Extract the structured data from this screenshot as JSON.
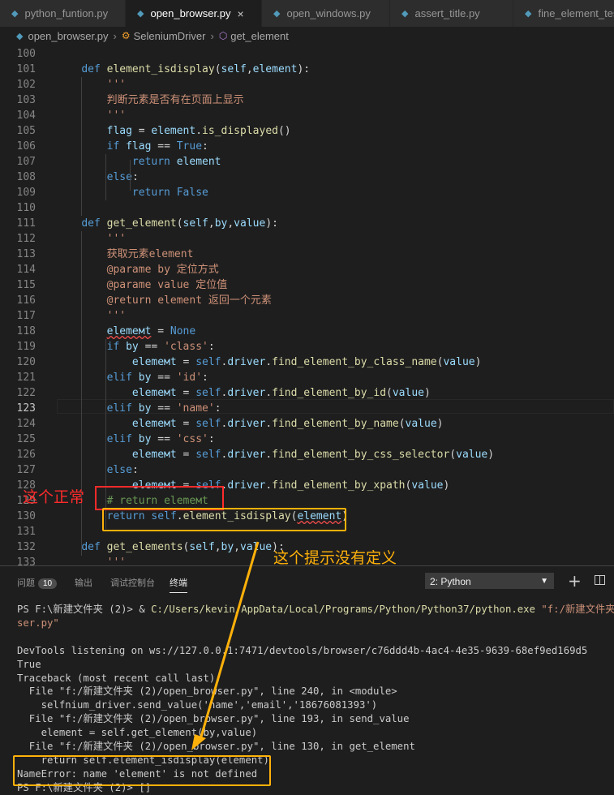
{
  "tabs": [
    {
      "label": "python_funtion.py",
      "active": false
    },
    {
      "label": "open_browser.py",
      "active": true
    },
    {
      "label": "open_windows.py",
      "active": false
    },
    {
      "label": "assert_title.py",
      "active": false
    },
    {
      "label": "fine_element_tes",
      "active": false
    }
  ],
  "breadcrumb": {
    "file": "open_browser.py",
    "class": "SeleniumDriver",
    "method": "get_element"
  },
  "code_lines": [
    {
      "n": "100",
      "html": ""
    },
    {
      "n": "101",
      "html": "    <span class='k'>def</span> <span class='f'>element_isdisplay</span>(<span class='v'>self</span>,<span class='v'>element</span>):"
    },
    {
      "n": "102",
      "html": "        <span class='s'>'''</span>"
    },
    {
      "n": "103",
      "html": "        <span class='s'>判断元素是否有在页面上显示</span>"
    },
    {
      "n": "104",
      "html": "        <span class='s'>'''</span>"
    },
    {
      "n": "105",
      "html": "        <span class='v'>flag</span> = <span class='v'>element</span>.<span class='f'>is_displayed</span>()"
    },
    {
      "n": "106",
      "html": "        <span class='k'>if</span> <span class='v'>flag</span> == <span class='k'>True</span>:"
    },
    {
      "n": "107",
      "html": "            <span class='k'>return</span> <span class='v'>element</span>"
    },
    {
      "n": "108",
      "html": "        <span class='k'>else</span>:"
    },
    {
      "n": "109",
      "html": "            <span class='k'>return</span> <span class='k'>False</span>"
    },
    {
      "n": "110",
      "html": ""
    },
    {
      "n": "111",
      "html": "    <span class='k'>def</span> <span class='f'>get_element</span>(<span class='v'>self</span>,<span class='v'>by</span>,<span class='v'>value</span>):"
    },
    {
      "n": "112",
      "html": "        <span class='s'>'''</span>"
    },
    {
      "n": "113",
      "html": "        <span class='s'>获取元素element</span>"
    },
    {
      "n": "114",
      "html": "        <span class='s'>@parame by 定位方式</span>"
    },
    {
      "n": "115",
      "html": "        <span class='s'>@parame value 定位值</span>"
    },
    {
      "n": "116",
      "html": "        <span class='s'>@return element 返回一个元素</span>"
    },
    {
      "n": "117",
      "html": "        <span class='s'>'''</span>"
    },
    {
      "n": "118",
      "html": "        <span class='v sq'>elemeмt</span> = <span class='k'>None</span>"
    },
    {
      "n": "119",
      "html": "        <span class='k'>if</span> <span class='v'>by</span> == <span class='s'>'class'</span>:"
    },
    {
      "n": "120",
      "html": "            <span class='v'>elemeмt</span> = <span class='k'>self</span>.<span class='v'>driver</span>.<span class='f'>find_element_by_class_name</span>(<span class='v'>value</span>)"
    },
    {
      "n": "121",
      "html": "        <span class='k'>elif</span> <span class='v'>by</span> == <span class='s'>'id'</span>:"
    },
    {
      "n": "122",
      "html": "            <span class='v'>elemeмt</span> = <span class='k'>self</span>.<span class='v'>driver</span>.<span class='f'>find_element_by_id</span>(<span class='v'>value</span>)"
    },
    {
      "n": "123",
      "html": "        <span class='k'>elif</span> <span class='v'>by</span> == <span class='s'>'name'</span>:"
    },
    {
      "n": "124",
      "html": "            <span class='v'>elemeмt</span> = <span class='k'>self</span>.<span class='v'>driver</span>.<span class='f'>find_element_by_name</span>(<span class='v'>value</span>)"
    },
    {
      "n": "125",
      "html": "        <span class='k'>elif</span> <span class='v'>by</span> == <span class='s'>'css'</span>:"
    },
    {
      "n": "126",
      "html": "            <span class='v'>elemeмt</span> = <span class='k'>self</span>.<span class='v'>driver</span>.<span class='f'>find_element_by_css_selector</span>(<span class='v'>value</span>)"
    },
    {
      "n": "127",
      "html": "        <span class='k'>else</span>:"
    },
    {
      "n": "128",
      "html": "            <span class='v'>elemeмt</span> = <span class='k'>self</span>.<span class='v'>driver</span>.<span class='f'>find_element_by_xpath</span>(<span class='v'>value</span>)"
    },
    {
      "n": "129",
      "html": "        <span class='c'># return elemeмt</span>"
    },
    {
      "n": "130",
      "html": "        <span class='k'>return</span> <span class='k'>self</span>.<span class='f'>element_isdisplay</span>(<span class='v sq'>element</span>)"
    },
    {
      "n": "131",
      "html": ""
    },
    {
      "n": "132",
      "html": "    <span class='k'>def</span> <span class='f'>get_elements</span>(<span class='v'>self</span>,<span class='v'>by</span>,<span class='v'>value</span>):"
    },
    {
      "n": "133",
      "html": "        <span class='s'>'''</span>"
    }
  ],
  "panel": {
    "tab_problems": "问题",
    "problems_count": "10",
    "tab_output": "输出",
    "tab_debug": "调试控制台",
    "tab_terminal": "终端",
    "terminal_select": "2: Python",
    "plus_icon": "+"
  },
  "terminal_lines": [
    "PS F:\\新建文件夹 (2)> & <span class='path'>C:/Users/kevin/AppData/Local/Programs/Python/Python37/python.exe</span> <span class='str'>\"f:/新建文件夹 (</span>",
    "<span class='str'>ser.py\"</span>",
    "",
    "DevTools listening on ws://127.0.0.1:7471/devtools/browser/c76ddd4b-4ac4-4e35-9639-68ef9ed169d5",
    "True",
    "Traceback (most recent call last):",
    "  File \"f:/新建文件夹 (2)/open_browser.py\", line 240, in &lt;module&gt;",
    "    selfnium_driver.send_value('name','email','18676081393')",
    "  File \"f:/新建文件夹 (2)/open_browser.py\", line 193, in send_value",
    "    element = self.get_element(by,value)",
    "  File \"f:/新建文件夹 (2)/open_browser.py\", line 130, in get_element",
    "    return self.element_isdisplay(element)",
    "NameError: name 'element' is not defined",
    "PS F:\\新建文件夹 (2)> []"
  ],
  "annotations": {
    "red_text": "这个正常",
    "yellow_text": "这个提示没有定义"
  }
}
